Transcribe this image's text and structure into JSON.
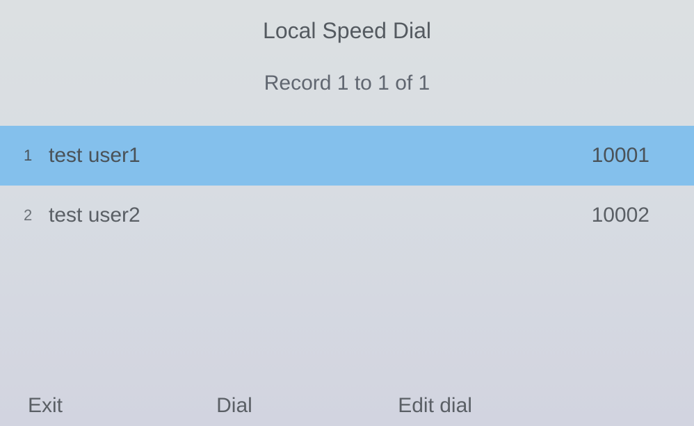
{
  "header": {
    "title": "Local Speed Dial",
    "subtitle": "Record 1 to 1 of 1"
  },
  "entries": [
    {
      "index": "1",
      "name": "test user1",
      "number": "10001",
      "selected": true
    },
    {
      "index": "2",
      "name": "test user2",
      "number": "10002",
      "selected": false
    }
  ],
  "softkeys": {
    "exit": "Exit",
    "dial": "Dial",
    "edit": "Edit dial"
  }
}
